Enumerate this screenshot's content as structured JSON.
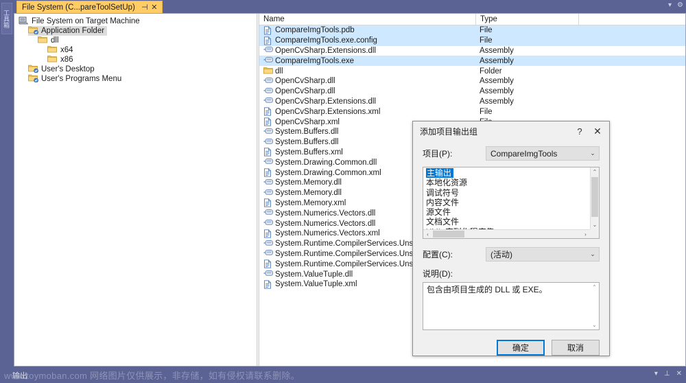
{
  "toolbox": {
    "label": "工具箱"
  },
  "tab": {
    "title": "File System (C...pareToolSetUp)",
    "pin_icon": "⊣",
    "close_icon": "✕"
  },
  "tabrow_controls": {
    "dropdown_icon": "▾",
    "gear_icon": "⚙"
  },
  "tree": {
    "nodes": [
      {
        "label": "File System on Target Machine",
        "icon": "computer-icon",
        "depth": 0,
        "selected": false
      },
      {
        "label": "Application Folder",
        "icon": "folder-special-icon",
        "depth": 1,
        "selected": true
      },
      {
        "label": "dll",
        "icon": "folder-icon",
        "depth": 2,
        "selected": false
      },
      {
        "label": "x64",
        "icon": "folder-icon",
        "depth": 3,
        "selected": false
      },
      {
        "label": "x86",
        "icon": "folder-icon",
        "depth": 3,
        "selected": false
      },
      {
        "label": "User's Desktop",
        "icon": "folder-special-icon",
        "depth": 1,
        "selected": false
      },
      {
        "label": "User's Programs Menu",
        "icon": "folder-special-icon",
        "depth": 1,
        "selected": false
      }
    ]
  },
  "listview": {
    "columns": [
      "Name",
      "Type"
    ],
    "rows": [
      {
        "name": "CompareImgTools.pdb",
        "type": "File",
        "icon": "document-icon",
        "selected": true
      },
      {
        "name": "CompareImgTools.exe.config",
        "type": "File",
        "icon": "document-icon",
        "selected": true
      },
      {
        "name": "OpenCvSharp.Extensions.dll",
        "type": "Assembly",
        "icon": "assembly-icon",
        "selected": false
      },
      {
        "name": "CompareImgTools.exe",
        "type": "Assembly",
        "icon": "assembly-icon",
        "selected": true
      },
      {
        "name": "dll",
        "type": "Folder",
        "icon": "folder-icon",
        "selected": false
      },
      {
        "name": "OpenCvSharp.dll",
        "type": "Assembly",
        "icon": "assembly-icon",
        "selected": false
      },
      {
        "name": "OpenCvSharp.dll",
        "type": "Assembly",
        "icon": "assembly-icon",
        "selected": false
      },
      {
        "name": "OpenCvSharp.Extensions.dll",
        "type": "Assembly",
        "icon": "assembly-icon",
        "selected": false
      },
      {
        "name": "OpenCvSharp.Extensions.xml",
        "type": "File",
        "icon": "document-icon",
        "selected": false
      },
      {
        "name": "OpenCvSharp.xml",
        "type": "File",
        "icon": "document-icon",
        "selected": false
      },
      {
        "name": "System.Buffers.dll",
        "type": "",
        "icon": "assembly-icon",
        "selected": false
      },
      {
        "name": "System.Buffers.dll",
        "type": "",
        "icon": "assembly-icon",
        "selected": false
      },
      {
        "name": "System.Buffers.xml",
        "type": "",
        "icon": "document-icon",
        "selected": false
      },
      {
        "name": "System.Drawing.Common.dll",
        "type": "",
        "icon": "assembly-icon",
        "selected": false
      },
      {
        "name": "System.Drawing.Common.xml",
        "type": "",
        "icon": "document-icon",
        "selected": false
      },
      {
        "name": "System.Memory.dll",
        "type": "",
        "icon": "assembly-icon",
        "selected": false
      },
      {
        "name": "System.Memory.dll",
        "type": "",
        "icon": "assembly-icon",
        "selected": false
      },
      {
        "name": "System.Memory.xml",
        "type": "",
        "icon": "document-icon",
        "selected": false
      },
      {
        "name": "System.Numerics.Vectors.dll",
        "type": "",
        "icon": "assembly-icon",
        "selected": false
      },
      {
        "name": "System.Numerics.Vectors.dll",
        "type": "",
        "icon": "assembly-icon",
        "selected": false
      },
      {
        "name": "System.Numerics.Vectors.xml",
        "type": "",
        "icon": "document-icon",
        "selected": false
      },
      {
        "name": "System.Runtime.CompilerServices.Unsafe.dll",
        "type": "",
        "icon": "assembly-icon",
        "selected": false
      },
      {
        "name": "System.Runtime.CompilerServices.Unsafe.dll",
        "type": "",
        "icon": "assembly-icon",
        "selected": false
      },
      {
        "name": "System.Runtime.CompilerServices.Unsafe.xml",
        "type": "",
        "icon": "document-icon",
        "selected": false
      },
      {
        "name": "System.ValueTuple.dll",
        "type": "",
        "icon": "assembly-icon",
        "selected": false
      },
      {
        "name": "System.ValueTuple.xml",
        "type": "",
        "icon": "document-icon",
        "selected": false
      }
    ]
  },
  "dialog": {
    "title": "添加项目输出组",
    "help_icon": "?",
    "close_icon": "✕",
    "project_label": "项目(P):",
    "project_value": "CompareImgTools",
    "outputs": [
      {
        "label": "主输出",
        "selected": true
      },
      {
        "label": "本地化资源",
        "selected": false
      },
      {
        "label": "调试符号",
        "selected": false
      },
      {
        "label": "内容文件",
        "selected": false
      },
      {
        "label": "源文件",
        "selected": false
      },
      {
        "label": "文档文件",
        "selected": false
      },
      {
        "label": "XML 序列化程序集",
        "selected": false
      }
    ],
    "config_label": "配置(C):",
    "config_value": "(活动)",
    "description_label": "说明(D):",
    "description_text": "包含由项目生成的 DLL 或 EXE。",
    "ok_label": "确定",
    "cancel_label": "取消",
    "scroll_up_icon": "⌃",
    "scroll_down_icon": "⌄",
    "scroll_left_icon": "‹",
    "scroll_right_icon": "›",
    "chevron_icon": "⌄"
  },
  "statusbar": {
    "output_tab": "输出",
    "dropdown_icon": "▾",
    "pin_icon": "⊥",
    "close_icon": "✕"
  },
  "watermark": {
    "text": "www.toymoban.com 网络图片仅供展示，非存储，如有侵权请联系删除。"
  },
  "colors": {
    "chrome": "#5b6394",
    "tab_active": "#ffcc66",
    "selection": "#cde8ff",
    "listbox_selection": "#0078d7",
    "primary_button_border": "#0078d7"
  }
}
